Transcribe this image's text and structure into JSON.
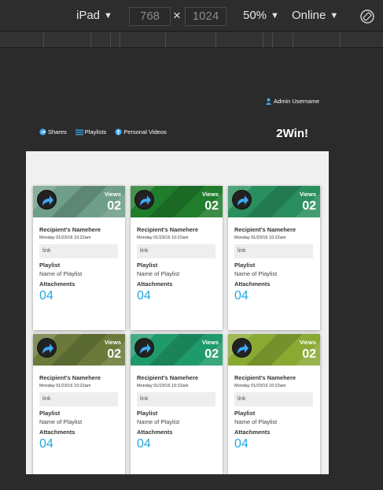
{
  "devtools": {
    "device": "iPad",
    "width": "768",
    "height": "1024",
    "times": "×",
    "zoom": "50%",
    "network": "Online",
    "caret": "▼"
  },
  "app": {
    "admin_label": "Admin Username",
    "brand": "2Win!",
    "nav": [
      {
        "label": "Shares",
        "icon": "share-icon"
      },
      {
        "label": "Playlists",
        "icon": "list-icon"
      },
      {
        "label": "Personal Videos",
        "icon": "video-icon"
      }
    ]
  },
  "cards": [
    {
      "views_label": "Views",
      "views": "02",
      "recipient": "Recipient's Namehere",
      "date": "Monday 01/23/16 10:22am",
      "link": "link",
      "playlist_label": "Playlist",
      "playlist": "Name of Playlist",
      "attachments_label": "Attachments",
      "attachments": "04",
      "thumb_color": "#6f9e8a"
    },
    {
      "views_label": "Views",
      "views": "02",
      "recipient": "Recipient's Namehere",
      "date": "Monday 01/23/16 10:22am",
      "link": "link",
      "playlist_label": "Playlist",
      "playlist": "Name of Playlist",
      "attachments_label": "Attachments",
      "attachments": "04",
      "thumb_color": "#1f7d2c"
    },
    {
      "views_label": "Views",
      "views": "02",
      "recipient": "Recipient's Namehere",
      "date": "Monday 01/23/16 10:22am",
      "link": "link",
      "playlist_label": "Playlist",
      "playlist": "Name of Playlist",
      "attachments_label": "Attachments",
      "attachments": "04",
      "thumb_color": "#2a8f5e"
    },
    {
      "views_label": "Views",
      "views": "02",
      "recipient": "Recipient's Namehere",
      "date": "Monday 01/23/16 10:22am",
      "link": "link",
      "playlist_label": "Playlist",
      "playlist": "Name of Playlist",
      "attachments_label": "Attachments",
      "attachments": "04",
      "thumb_color": "#6a7a3a"
    },
    {
      "views_label": "Views",
      "views": "02",
      "recipient": "Recipient's Namehere",
      "date": "Monday 01/23/16 10:22am",
      "link": "link",
      "playlist_label": "Playlist",
      "playlist": "Name of Playlist",
      "attachments_label": "Attachments",
      "attachments": "04",
      "thumb_color": "#1f9a6a"
    },
    {
      "views_label": "Views",
      "views": "02",
      "recipient": "Recipient's Namehere",
      "date": "Monday 01/23/16 10:22am",
      "link": "link",
      "playlist_label": "Playlist",
      "playlist": "Name of Playlist",
      "attachments_label": "Attachments",
      "attachments": "04",
      "thumb_color": "#8aa933"
    }
  ],
  "colors": {
    "accent": "#23a8e0",
    "header_bg": "#2b2b2b",
    "viewport_bg": "#f0f0f0"
  }
}
